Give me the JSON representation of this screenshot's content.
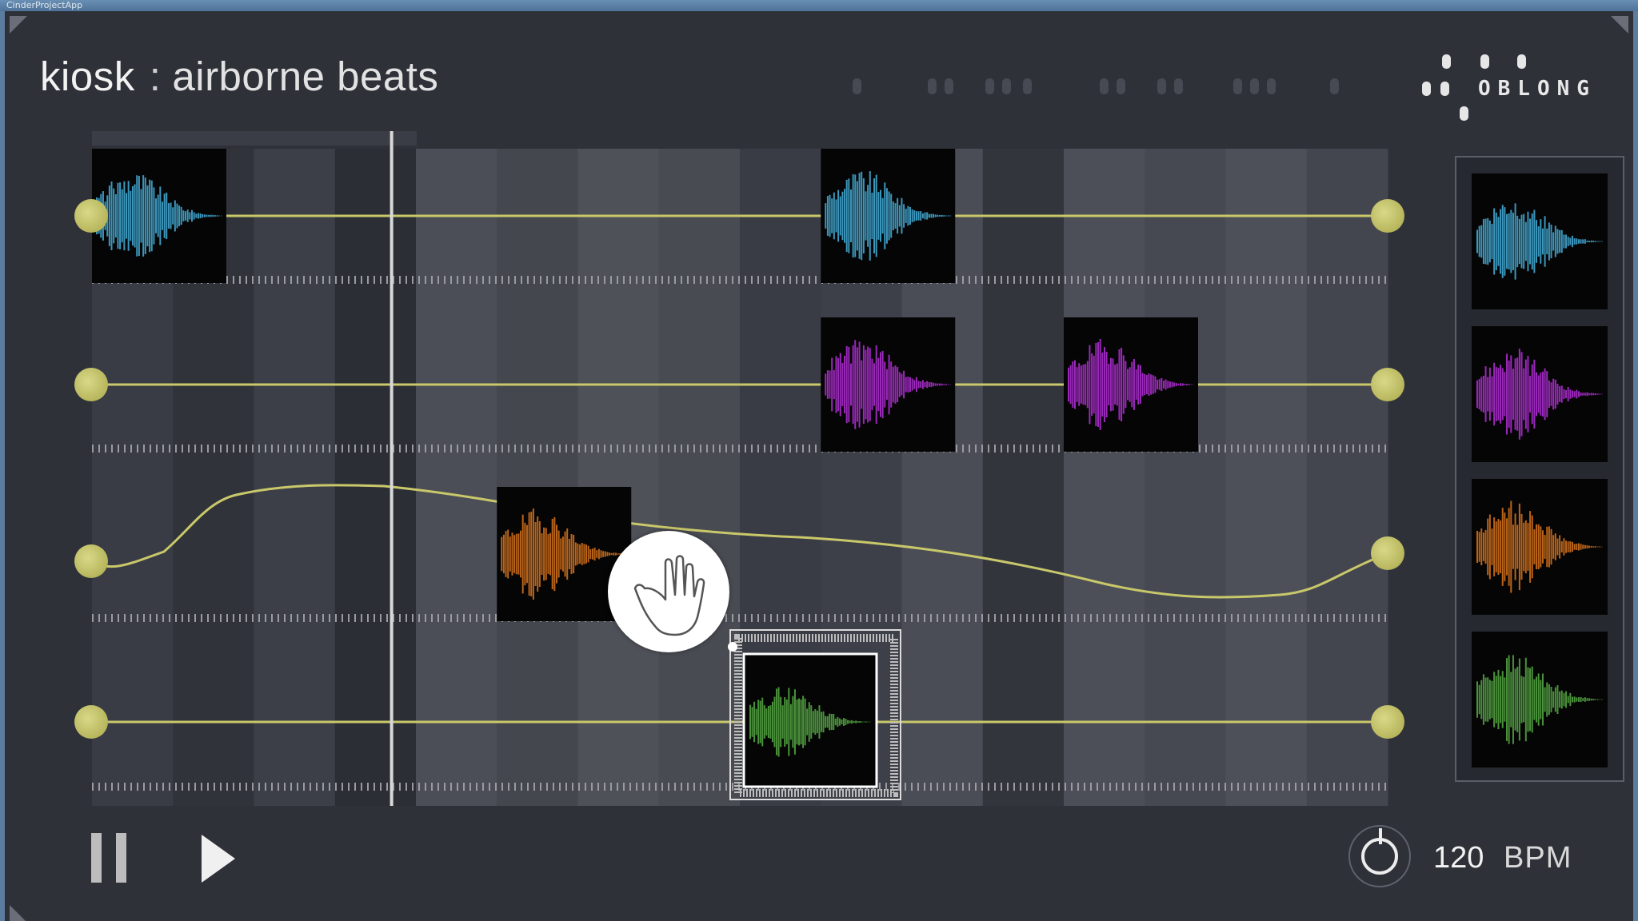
{
  "window": {
    "title": "CinderProjectApp"
  },
  "header": {
    "app_name": "kiosk",
    "separator": ":",
    "subtitle": "airborne beats"
  },
  "logo": {
    "text": "OBLONG"
  },
  "transport": {
    "state": "paused",
    "bpm": "120",
    "bpm_unit": "BPM"
  },
  "tracks": [
    {
      "name": "track-1",
      "color": "#3f9fc7",
      "clips_at_steps": [
        0,
        9
      ]
    },
    {
      "name": "track-2",
      "color": "#a32bc4",
      "clips_at_steps": [
        9,
        12
      ]
    },
    {
      "name": "track-3",
      "color": "#c46a1c",
      "clips_at_steps": [
        5
      ]
    },
    {
      "name": "track-4",
      "color": "#4e9a3e",
      "clips_at_steps": [
        8
      ]
    }
  ],
  "sample_palette": [
    {
      "name": "blue-sample",
      "color": "#3f9fc7"
    },
    {
      "name": "purple-sample",
      "color": "#a32bc4"
    },
    {
      "name": "orange-sample",
      "color": "#c46a1c"
    },
    {
      "name": "green-sample",
      "color": "#4e9a3e"
    }
  ],
  "timeline": {
    "steps": 16,
    "playhead_step": 3.7,
    "selected_track": 4,
    "selected_step": 8
  },
  "colors": {
    "accent": "#c9c86a",
    "background": "#2f3139",
    "text": "#f2f2f2"
  },
  "icons": {
    "logo": "oblong-dots-icon",
    "pause": "pause-icon",
    "play": "play-icon",
    "knob": "bpm-knob-icon",
    "hand": "hand-cursor-icon"
  }
}
